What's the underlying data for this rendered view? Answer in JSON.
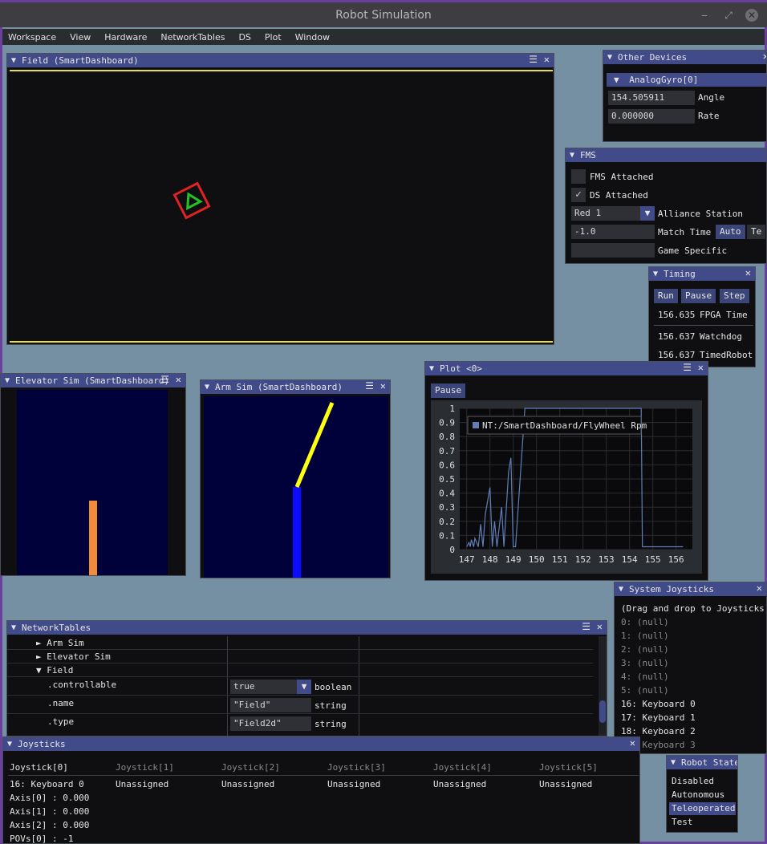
{
  "window": {
    "title": "Robot Simulation"
  },
  "menu": [
    "Workspace",
    "View",
    "Hardware",
    "NetworkTables",
    "DS",
    "Plot",
    "Window"
  ],
  "field_window": {
    "title": "Field (SmartDashboard)"
  },
  "other_devices": {
    "title": "Other Devices",
    "device": "AnalogGyro[0]",
    "angle_value": "154.505911",
    "angle_label": "Angle",
    "rate_value": "0.000000",
    "rate_label": "Rate"
  },
  "fms": {
    "title": "FMS",
    "fms_attached": "FMS Attached",
    "ds_attached": "DS Attached",
    "alliance_value": "Red 1",
    "alliance_label": "Alliance Station",
    "match_time_value": "-1.0",
    "match_time_label": "Match Time",
    "auto_btn": "Auto",
    "tele_btn": "Te",
    "game_specific_label": "Game Specific"
  },
  "timing": {
    "title": "Timing",
    "run": "Run",
    "pause": "Pause",
    "step": "Step",
    "fpga_value": "156.635",
    "fpga_label": "FPGA Time",
    "watchdog_value": "156.637",
    "watchdog_label": "Watchdog",
    "timed_value": "156.637",
    "timed_label": "TimedRobot"
  },
  "elevator": {
    "title": "Elevator Sim (SmartDashboard)"
  },
  "arm": {
    "title": "Arm Sim (SmartDashboard)"
  },
  "plot": {
    "title": "Plot <0>",
    "pause": "Pause",
    "legend": "NT:/SmartDashboard/FlyWheel Rpm"
  },
  "chart_data": {
    "type": "line",
    "series": [
      {
        "name": "NT:/SmartDashboard/FlyWheel Rpm",
        "x": [
          147,
          147.1,
          147.15,
          147.2,
          147.3,
          147.35,
          147.5,
          147.6,
          147.7,
          147.8,
          148,
          148.1,
          148.2,
          148.3,
          148.5,
          148.6,
          148.8,
          148.9,
          149,
          149.1,
          149.5,
          149.8,
          149.9,
          154.5,
          154.55,
          154.6,
          156.3
        ],
        "y": [
          0.02,
          0.05,
          0.02,
          0.07,
          0.02,
          0.08,
          0.02,
          0.18,
          0.02,
          0.25,
          0.44,
          0.02,
          0.2,
          0.02,
          0.3,
          0.02,
          0.55,
          0.65,
          0.02,
          0.02,
          1.0,
          1.0,
          1.0,
          1.0,
          0.02,
          0.02,
          0.02
        ]
      }
    ],
    "xticks": [
      "147",
      "148",
      "149",
      "150",
      "151",
      "152",
      "153",
      "154",
      "155",
      "156"
    ],
    "yticks": [
      "0",
      "0.1",
      "0.2",
      "0.3",
      "0.4",
      "0.5",
      "0.6",
      "0.7",
      "0.8",
      "0.9",
      "1"
    ],
    "xlim": [
      146.7,
      156.7
    ],
    "ylim": [
      0,
      1
    ],
    "grid": true,
    "legend_position": "top-left"
  },
  "sys_joysticks": {
    "title": "System Joysticks",
    "hint": "(Drag and drop to Joysticks)",
    "items": [
      "0: (null)",
      "1: (null)",
      "2: (null)",
      "3: (null)",
      "4: (null)",
      "5: (null)",
      "16: Keyboard 0",
      "17: Keyboard 1",
      "18: Keyboard 2",
      "19: Keyboard 3"
    ]
  },
  "nt": {
    "title": "NetworkTables",
    "arm_sim": "Arm Sim",
    "elevator_sim": "Elevator Sim",
    "field": "Field",
    "controllable": ".controllable",
    "controllable_value": "true",
    "controllable_type": "boolean",
    "name_key": ".name",
    "name_value": "\"Field\"",
    "name_type": "string",
    "type_key": ".type",
    "type_value": "\"Field2d\"",
    "type_type": "string"
  },
  "joysticks": {
    "title": "Joysticks",
    "headers": [
      "Joystick[0]",
      "Joystick[1]",
      "Joystick[2]",
      "Joystick[3]",
      "Joystick[4]",
      "Joystick[5]"
    ],
    "assign": [
      "16: Keyboard 0",
      "Unassigned",
      "Unassigned",
      "Unassigned",
      "Unassigned",
      "Unassigned"
    ],
    "axes": [
      "Axis[0] : 0.000",
      "Axis[1] : 0.000",
      "Axis[2] : 0.000",
      "POVs[0] : -1"
    ]
  },
  "robot_state": {
    "title": "Robot State",
    "items": [
      "Disabled",
      "Autonomous",
      "Teleoperated",
      "Test"
    ],
    "selected": "Teleoperated"
  }
}
